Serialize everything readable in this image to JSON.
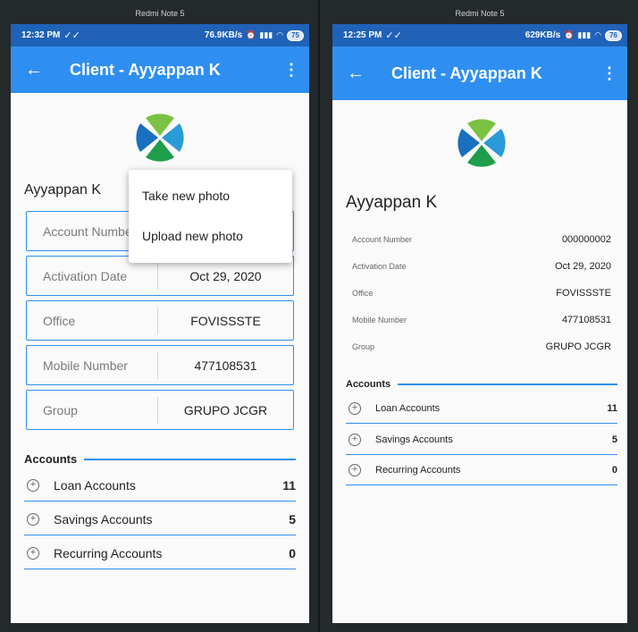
{
  "left": {
    "device_label": "Redmi Note 5",
    "status": {
      "time": "12:32 PM",
      "net_speed": "76.9KB/s",
      "battery": "75"
    },
    "appbar": {
      "title": "Client - Ayyappan K"
    },
    "client_name": "Ayyappan K",
    "fields": [
      {
        "label": "Account Number",
        "value": ""
      },
      {
        "label": "Activation Date",
        "value": "Oct 29, 2020"
      },
      {
        "label": "Office",
        "value": "FOVISSSTE"
      },
      {
        "label": "Mobile Number",
        "value": "477108531"
      },
      {
        "label": "Group",
        "value": "GRUPO JCGR"
      }
    ],
    "accounts_header": "Accounts",
    "accounts": [
      {
        "label": "Loan Accounts",
        "count": "11"
      },
      {
        "label": "Savings Accounts",
        "count": "5"
      },
      {
        "label": "Recurring Accounts",
        "count": "0"
      }
    ],
    "popup": [
      "Take new photo",
      "Upload new photo"
    ]
  },
  "right": {
    "device_label": "Redmi Note 5",
    "status": {
      "time": "12:25 PM",
      "net_speed": "629KB/s",
      "battery": "76"
    },
    "appbar": {
      "title": "Client - Ayyappan K"
    },
    "client_name": "Ayyappan K",
    "fields": [
      {
        "label": "Account Number",
        "value": "000000002"
      },
      {
        "label": "Activation Date",
        "value": "Oct 29, 2020"
      },
      {
        "label": "Office",
        "value": "FOVISSSTE"
      },
      {
        "label": "Mobile Number",
        "value": "477108531"
      },
      {
        "label": "Group",
        "value": "GRUPO JCGR"
      }
    ],
    "accounts_header": "Accounts",
    "accounts": [
      {
        "label": "Loan Accounts",
        "count": "11"
      },
      {
        "label": "Savings Accounts",
        "count": "5"
      },
      {
        "label": "Recurring Accounts",
        "count": "0"
      }
    ]
  },
  "colors": {
    "status_bar": "#1f62b8",
    "app_bar": "#2f8ff0",
    "logo_green": "#7cc242",
    "logo_blue": "#1a6fbf",
    "logo_light_blue": "#2a9bd8",
    "logo_dark_green": "#1e9e4a"
  },
  "icons": [
    "back-arrow-icon",
    "more-vert-icon",
    "plus-circle-icon",
    "wifi-icon",
    "signal-icon",
    "alarm-icon",
    "battery-icon"
  ]
}
